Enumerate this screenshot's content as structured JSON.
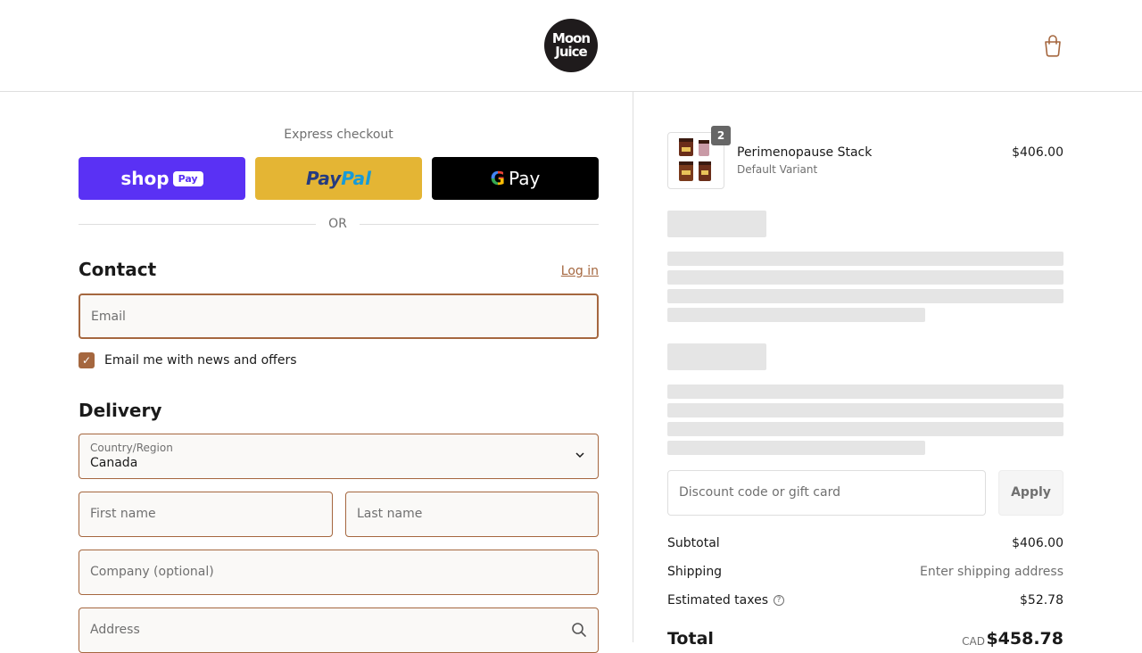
{
  "header": {
    "logo_line1": "Moon",
    "logo_line2": "Juice",
    "cart_icon": "shopping-bag-icon"
  },
  "express": {
    "title": "Express checkout",
    "shop_label": "shop",
    "shop_badge": "Pay",
    "paypal_pay": "Pay",
    "paypal_pal": "Pal",
    "gpay_g": "G",
    "gpay_label": "Pay",
    "or": "OR"
  },
  "contact": {
    "heading": "Contact",
    "login": "Log in",
    "email_placeholder": "Email",
    "news_checked": true,
    "news_label": "Email me with news and offers"
  },
  "delivery": {
    "heading": "Delivery",
    "country_label": "Country/Region",
    "country_value": "Canada",
    "first_name_placeholder": "First name",
    "last_name_placeholder": "Last name",
    "company_placeholder": "Company (optional)",
    "address_placeholder": "Address"
  },
  "order": {
    "item": {
      "quantity": "2",
      "name": "Perimenopause Stack",
      "variant": "Default Variant",
      "price": "$406.00"
    },
    "discount_placeholder": "Discount code or gift card",
    "apply_label": "Apply",
    "subtotal_label": "Subtotal",
    "subtotal_value": "$406.00",
    "shipping_label": "Shipping",
    "shipping_value": "Enter shipping address",
    "taxes_label": "Estimated taxes",
    "taxes_value": "$52.78",
    "total_label": "Total",
    "total_currency": "CAD",
    "total_value": "$458.78"
  },
  "colors": {
    "accent": "#a5673f",
    "shop_pay": "#5a31f4",
    "paypal": "#e4b534",
    "gpay": "#000000"
  }
}
